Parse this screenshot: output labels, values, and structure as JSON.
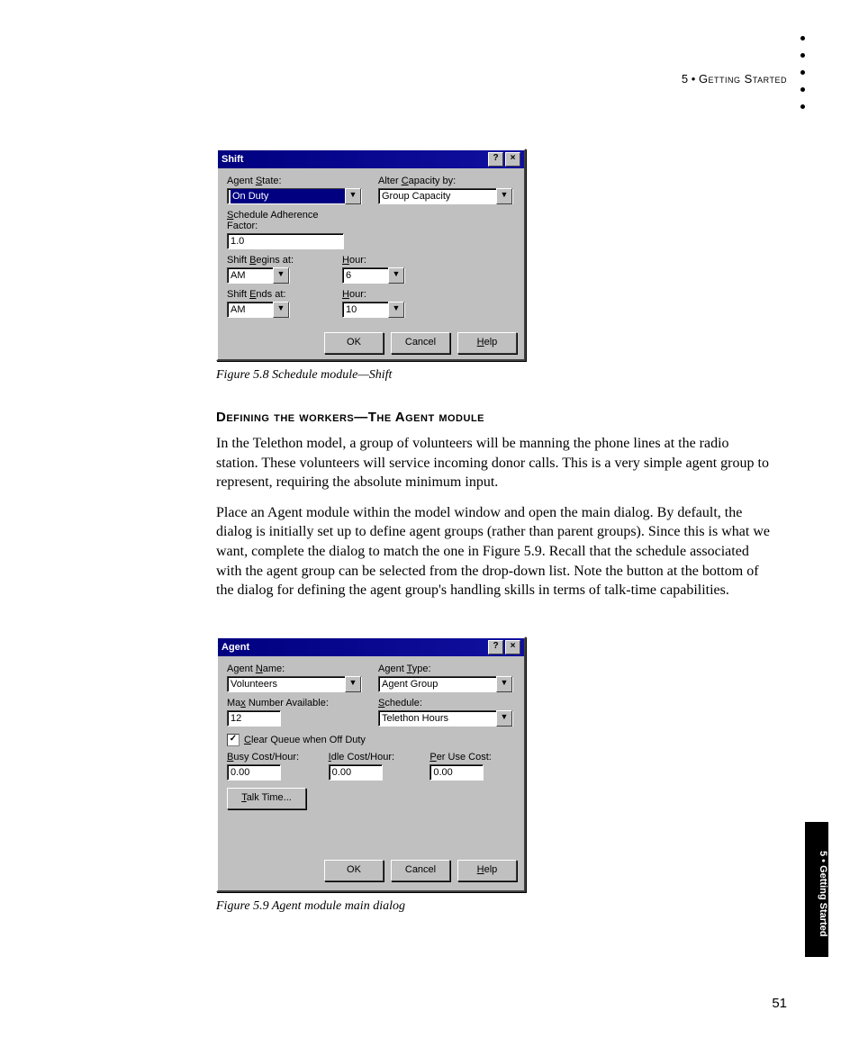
{
  "header": {
    "chapter_number": "5",
    "separator": "•",
    "chapter_title": "Getting Started"
  },
  "dialog1": {
    "title": "Shift",
    "labels": {
      "agent_state_pre": "Agent ",
      "agent_state_u": "S",
      "agent_state_post": "tate:",
      "alter_pre": "Alter ",
      "alter_u": "C",
      "alter_post": "apacity by:",
      "schedule_u": "S",
      "schedule_post": "chedule Adherence Factor:",
      "shift_begins_pre": "Shift ",
      "shift_begins_u": "B",
      "shift_begins_post": "egins at:",
      "hour1_u": "H",
      "hour1_post": "our:",
      "shift_ends_pre": "Shift ",
      "shift_ends_u": "E",
      "shift_ends_post": "nds at:",
      "hour2_u": "H",
      "hour2_post": "our:"
    },
    "values": {
      "agent_state": "On Duty",
      "alter_capacity": "Group Capacity",
      "schedule_factor": "1.0",
      "begins_ampm": "AM",
      "begins_hour": "6",
      "ends_ampm": "AM",
      "ends_hour": "10"
    },
    "buttons": {
      "ok": "OK",
      "cancel": "Cancel",
      "help_u": "H",
      "help_post": "elp"
    }
  },
  "caption1": "Figure 5.8 Schedule module—Shift",
  "heading": "Defining the workers—The Agent module",
  "para1": "In the Telethon model, a group of volunteers will be manning the phone lines at the radio station. These volunteers will service incoming donor calls. This is a very simple agent group to represent, requiring the absolute minimum input.",
  "para2": "Place an Agent module within the model window and open the main dialog. By default, the dialog is initially set up to define agent groups (rather than parent groups). Since this is what we want, complete the dialog to match the one in Figure 5.9. Recall that the schedule associated with the agent group can be selected from the drop-down list. Note the button at the bottom of the dialog for defining the agent group's handling skills in terms of talk-time capabilities.",
  "dialog2": {
    "title": "Agent",
    "labels": {
      "name_pre": "Agent ",
      "name_u": "N",
      "name_post": "ame:",
      "type_pre": "Agent ",
      "type_u": "T",
      "type_post": "ype:",
      "max_pre": "Ma",
      "max_u": "x",
      "max_post": " Number Available:",
      "schedule_pre": "",
      "schedule_u": "S",
      "schedule_post": "chedule:",
      "clear_u": "C",
      "clear_post": "lear Queue when Off Duty",
      "busy_u": "B",
      "busy_post": "usy Cost/Hour:",
      "idle_u": "I",
      "idle_post": "dle Cost/Hour:",
      "per_u": "P",
      "per_post": "er Use Cost:"
    },
    "values": {
      "name": "Volunteers",
      "type": "Agent Group",
      "max": "12",
      "schedule": "Telethon Hours",
      "clear_checked": "✓",
      "busy": "0.00",
      "idle": "0.00",
      "per": "0.00"
    },
    "buttons": {
      "talk_u": "T",
      "talk_post": "alk Time...",
      "ok": "OK",
      "cancel": "Cancel",
      "help_u": "H",
      "help_post": "elp"
    }
  },
  "caption2": "Figure 5.9 Agent module main dialog",
  "side_tab": "5 • Getting Started",
  "page_number": "51"
}
